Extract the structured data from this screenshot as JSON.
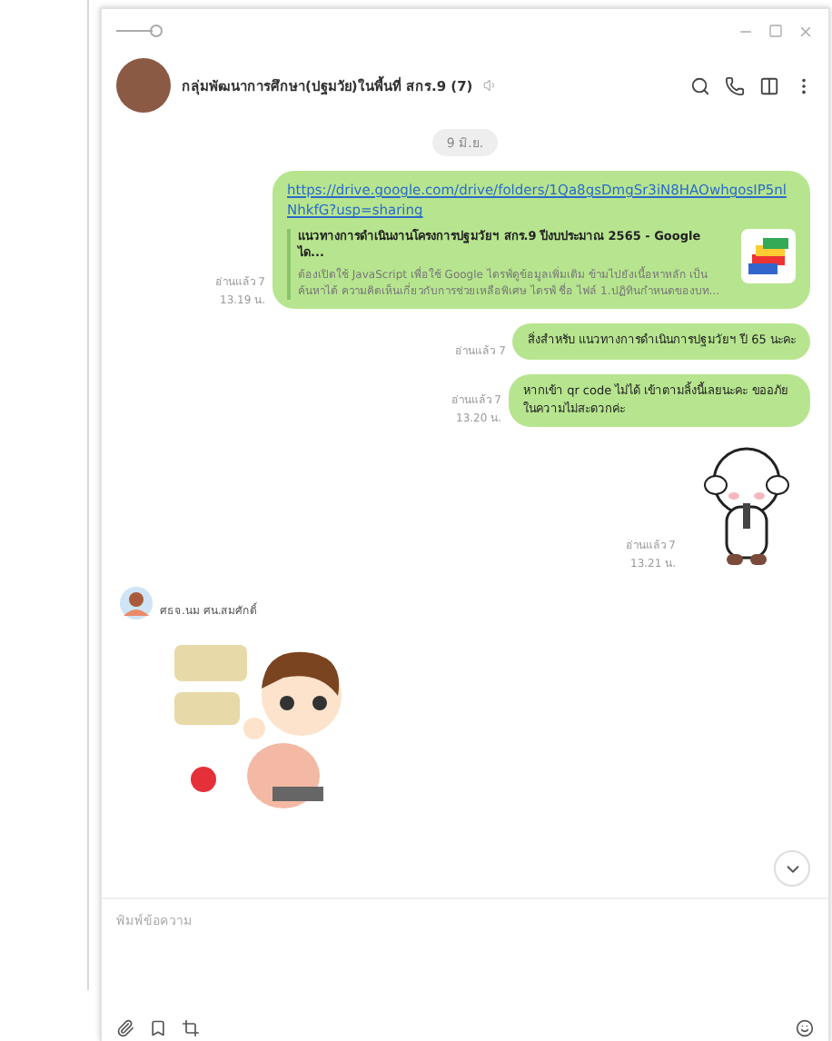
{
  "header": {
    "title": "กลุ่มพัฒนาการศึกษา(ปฐมวัย)ในพื้นที่ สกร.9 (7)",
    "muted": true
  },
  "date_divider": "9 มิ.ย.",
  "messages": [
    {
      "kind": "link",
      "outgoing": true,
      "url": "https://drive.google.com/drive/folders/1Qa8gsDmgSr3iN8HAOwhgosIP5nlNhkfG?usp=sharing",
      "preview_title": "แนวทางการดำเนินงานโครงการปฐมวัยฯ สกร.9 ปีงบประมาณ 2565 - Google ได...",
      "preview_text": "ต้องเปิดใช้ JavaScript เพื่อใช้ Google ไดรฟ์ดูข้อมูลเพิ่มเติม ข้ามไปยังเนื้อหาหลัก เป็นค้นหาได้ ความคิดเห็นเกี่ยวกับการช่วยเหลือพิเศษ ไดรฟ์ ชื่อ ไฟล์ 1.ปฏิทินกำหนดของบท...",
      "read": "อ่านแล้ว 7",
      "time": "13.19 น."
    },
    {
      "kind": "text",
      "outgoing": true,
      "text": "สิ่งสำหรับ แนวทางการดำเนินการปฐมวัยฯ ปี 65 นะคะ",
      "read": "อ่านแล้ว 7"
    },
    {
      "kind": "text",
      "outgoing": true,
      "text": "หากเข้า qr code ไม่ได้ เข้าตามลิ้งนี้เลยนะคะ ขออภัยในความไม่สะดวกค่ะ",
      "read": "อ่านแล้ว 7",
      "time": "13.20 น."
    },
    {
      "kind": "sticker",
      "outgoing": true,
      "read": "อ่านแล้ว 7",
      "time": "13.21 น."
    },
    {
      "kind": "sticker",
      "outgoing": false,
      "sender": "ศธจ.นม ศน.สมศักดิ์"
    }
  ],
  "composer": {
    "placeholder": "พิมพ์ข้อความ"
  }
}
